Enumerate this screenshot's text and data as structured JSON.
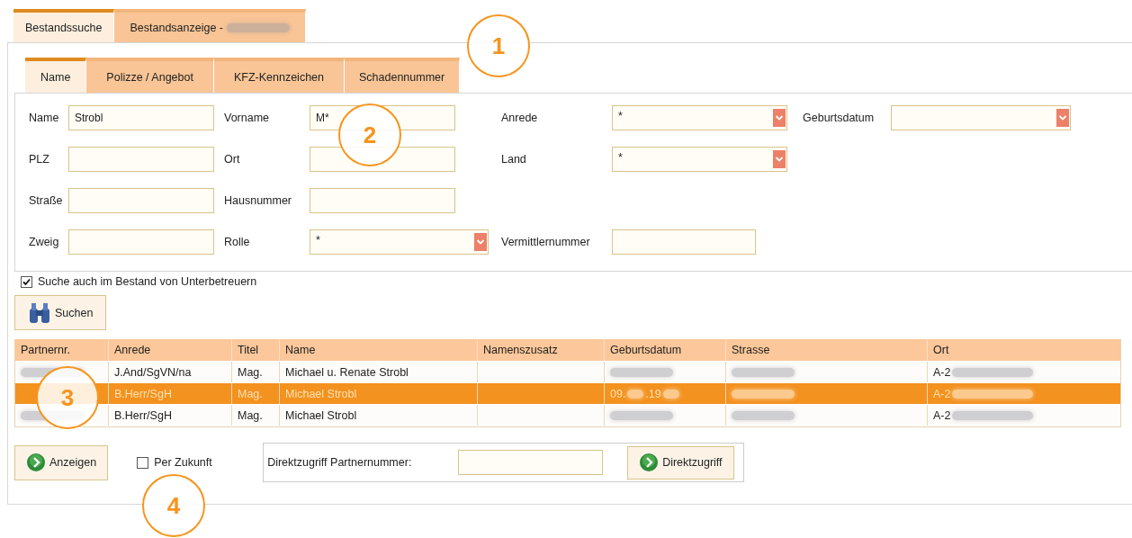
{
  "outer_tabs": [
    {
      "label": "Bestandssuche",
      "selected": true,
      "blurred_suffix": false
    },
    {
      "label": "Bestandsanzeige -",
      "selected": false,
      "blurred_suffix": true
    }
  ],
  "search_tabs": [
    {
      "label": "Name",
      "selected": true
    },
    {
      "label": "Polizze / Angebot",
      "selected": false
    },
    {
      "label": "KFZ-Kennzeichen",
      "selected": false
    },
    {
      "label": "Schadennummer",
      "selected": false
    }
  ],
  "form_rows": [
    [
      {
        "label": "Name",
        "kind": "text",
        "value": "Strobl"
      },
      {
        "label": "Vorname",
        "kind": "text",
        "value": "M*"
      },
      {
        "label": "Anrede",
        "kind": "select",
        "value": "*"
      },
      {
        "label": "Geburtsdatum",
        "kind": "select"
      }
    ],
    [
      {
        "label": "PLZ",
        "kind": "text"
      },
      {
        "label": "Ort",
        "kind": "text"
      },
      {
        "label": "Land",
        "kind": "select",
        "value": "*"
      }
    ],
    [
      {
        "label": "Straße",
        "kind": "text"
      },
      {
        "label": "Hausnummer",
        "kind": "text"
      }
    ],
    [
      {
        "label": "Zweig",
        "kind": "text"
      },
      {
        "label": "Rolle",
        "kind": "select",
        "value": "*"
      },
      {
        "label": "Vermittlernummer",
        "kind": "text"
      }
    ]
  ],
  "subagent_option": {
    "label": "Suche auch im Bestand von Unterbetreuern",
    "checked": true
  },
  "search_button": "Suchen",
  "table": {
    "columns": [
      "Partnernr.",
      "Anrede",
      "Titel",
      "Name",
      "Namenszusatz",
      "Geburtsdatum",
      "Strasse",
      "Ort"
    ],
    "rows": [
      {
        "selected": false,
        "cells": [
          [
            {
              "blur": true
            }
          ],
          [
            "J.And/SgVN/na"
          ],
          [
            "Mag."
          ],
          [
            "Michael u. Renate Strobl"
          ],
          [],
          [
            {
              "blur": true
            }
          ],
          [
            {
              "blur": true
            }
          ],
          [
            "A-2",
            {
              "blur": true
            }
          ]
        ]
      },
      {
        "selected": true,
        "cells": [
          [],
          [
            "B.Herr/SgH"
          ],
          [
            "Mag."
          ],
          [
            "Michael Strobl"
          ],
          [],
          [
            "09.",
            {
              "blur": true
            },
            ".19",
            {
              "blur": true
            }
          ],
          [
            {
              "blur": true
            }
          ],
          [
            "A-2",
            {
              "blur": true
            }
          ]
        ]
      },
      {
        "selected": false,
        "cells": [
          [
            {
              "blur": true
            }
          ],
          [
            "B.Herr/SgH"
          ],
          [
            "Mag."
          ],
          [
            "Michael Strobl"
          ],
          [],
          [
            {
              "blur": true
            }
          ],
          [
            {
              "blur": true
            }
          ],
          [
            "A-2",
            {
              "blur": true
            }
          ]
        ]
      }
    ]
  },
  "show_button": "Anzeigen",
  "future_option": {
    "label": "Per Zukunft",
    "checked": false
  },
  "direct_access": {
    "label": "Direktzugriff Partnernummer:",
    "button": "Direktzugriff"
  },
  "callouts": [
    "1",
    "2",
    "3",
    "4"
  ]
}
